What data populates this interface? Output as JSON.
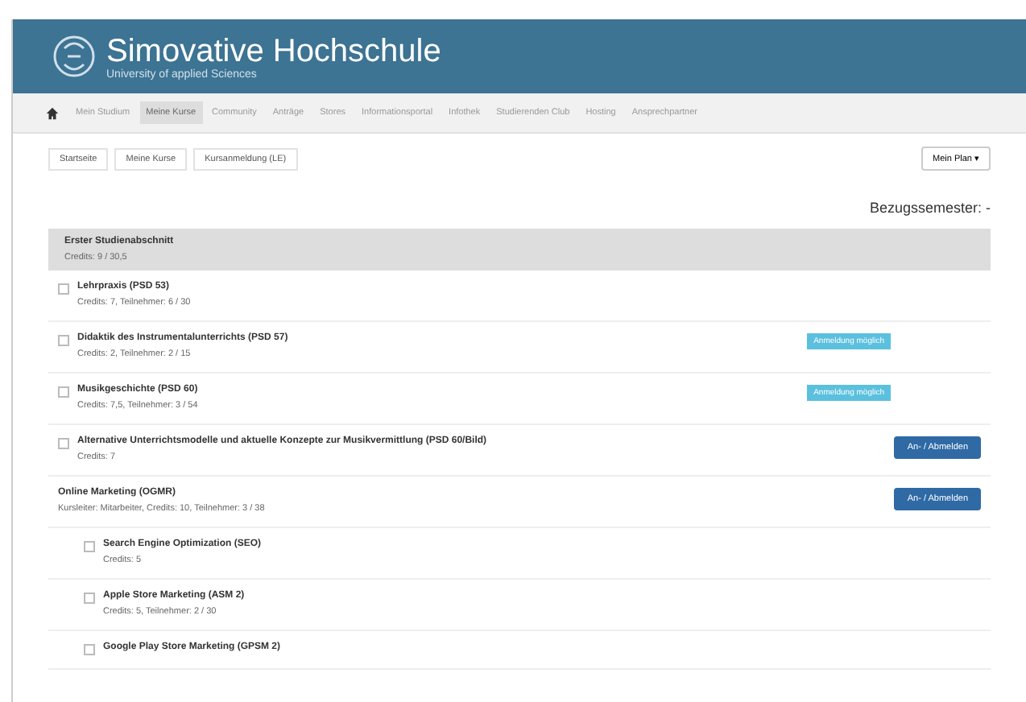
{
  "header": {
    "title": "Simovative Hochschule",
    "subtitle": "University of applied Sciences"
  },
  "nav": [
    {
      "label": "Mein Studium",
      "selected": false
    },
    {
      "label": "Meine Kurse",
      "selected": true
    },
    {
      "label": "Community",
      "selected": false
    },
    {
      "label": "Anträge",
      "selected": false
    },
    {
      "label": "Stores",
      "selected": false
    },
    {
      "label": "Informationsportal",
      "selected": false
    },
    {
      "label": "Infothek",
      "selected": false
    },
    {
      "label": "Studierenden Club",
      "selected": false
    },
    {
      "label": "Hosting",
      "selected": false
    },
    {
      "label": "Ansprechpartner",
      "selected": false
    }
  ],
  "breadcrumbs": [
    "Startseite",
    "Meine Kurse",
    "Kursanmeldung (LE)"
  ],
  "plan_button": "Mein Plan ▾",
  "semester": "Bezugssemester: -",
  "section": {
    "title": "Erster Studienabschnitt",
    "info": "Credits: 9 / 30,5"
  },
  "courses": [
    {
      "title": "Lehrpraxis (PSD 53)",
      "info": "Credits: 7, Teilnehmer: 6 / 30",
      "checked": false
    },
    {
      "title": "Didaktik des Instrumentalunterrichts (PSD 57)",
      "info": "Credits: 2, Teilnehmer: 2 / 15",
      "checked": false,
      "badge": "Anmeldung möglich"
    },
    {
      "title": "Musikgeschichte (PSD 60)",
      "info": "Credits: 7,5, Teilnehmer: 3 / 54",
      "checked": false,
      "badge": "Anmeldung möglich"
    },
    {
      "title": "Alternative Unterrichtsmodelle und aktuelle Konzepte zur Musikvermittlung (PSD 60/Bild)",
      "info": "Credits: 7",
      "checked": false,
      "button": "An- / Abmelden"
    },
    {
      "title": "Online Marketing (OGMR)",
      "info": "Kursleiter: Mitarbeiter, Credits: 10, Teilnehmer: 3 / 38",
      "button": "An- / Abmelden",
      "children": [
        {
          "title": "Search Engine Optimization (SEO)",
          "info": "Credits: 5",
          "checked": false
        },
        {
          "title": "Apple Store Marketing (ASM 2)",
          "info": "Credits: 5, Teilnehmer: 2 / 30",
          "checked": false
        },
        {
          "title": "Google Play Store Marketing (GPSM 2)",
          "checked": false
        }
      ]
    }
  ]
}
